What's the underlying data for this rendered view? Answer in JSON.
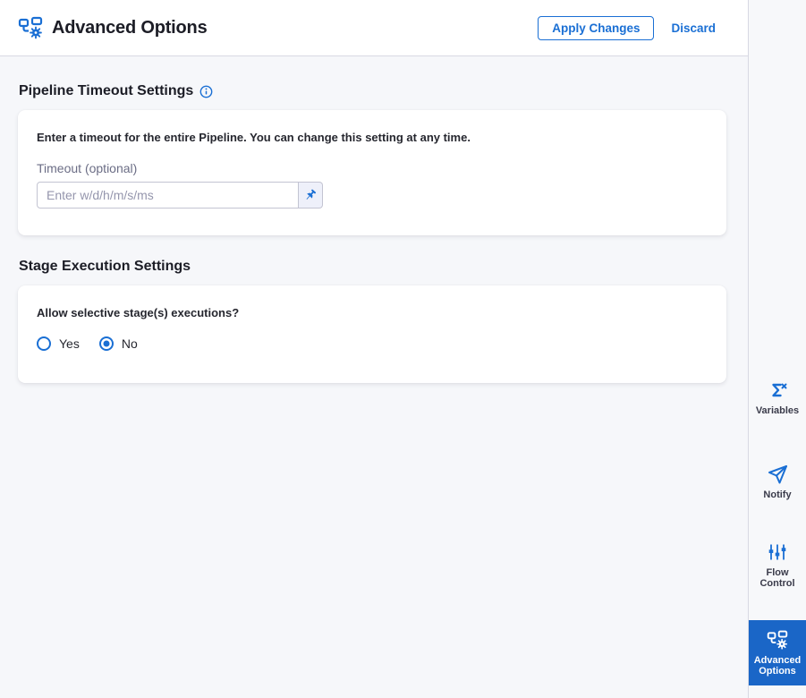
{
  "header": {
    "icon": "pipeline-gear-icon",
    "title": "Advanced Options",
    "apply_button": "Apply Changes",
    "discard_button": "Discard"
  },
  "sections": {
    "pipeline_timeout": {
      "heading": "Pipeline Timeout Settings",
      "info_icon": "info-icon",
      "description": "Enter a timeout for the entire Pipeline. You can change this setting at any time.",
      "timeout_field": {
        "label": "Timeout (optional)",
        "value": "",
        "placeholder": "Enter w/d/h/m/s/ms",
        "input_type_icon": "pin-icon"
      }
    },
    "stage_execution": {
      "heading": "Stage Execution Settings",
      "question": "Allow selective stage(s) executions?",
      "options": [
        {
          "label": "Yes",
          "selected": false
        },
        {
          "label": "No",
          "selected": true
        }
      ]
    }
  },
  "sidebar": {
    "items": [
      {
        "label": "Variables",
        "icon": "sigma-variables-icon",
        "selected": false
      },
      {
        "label": "Notify",
        "icon": "paper-plane-icon",
        "selected": false
      },
      {
        "label": "Flow Control",
        "icon": "sliders-icon",
        "selected": false
      },
      {
        "label": "Advanced Options",
        "icon": "pipeline-gear-icon",
        "selected": true
      }
    ]
  },
  "colors": {
    "primary": "#1a6fd4",
    "nav_selected_bg": "#1a66c7",
    "heading_text": "#1c1d26",
    "body_text": "#26272f",
    "muted_label": "#6b6d85",
    "placeholder": "#9596ad",
    "border": "#d8d9e3",
    "content_bg": "#f6f7fa",
    "card_bg": "#ffffff"
  }
}
